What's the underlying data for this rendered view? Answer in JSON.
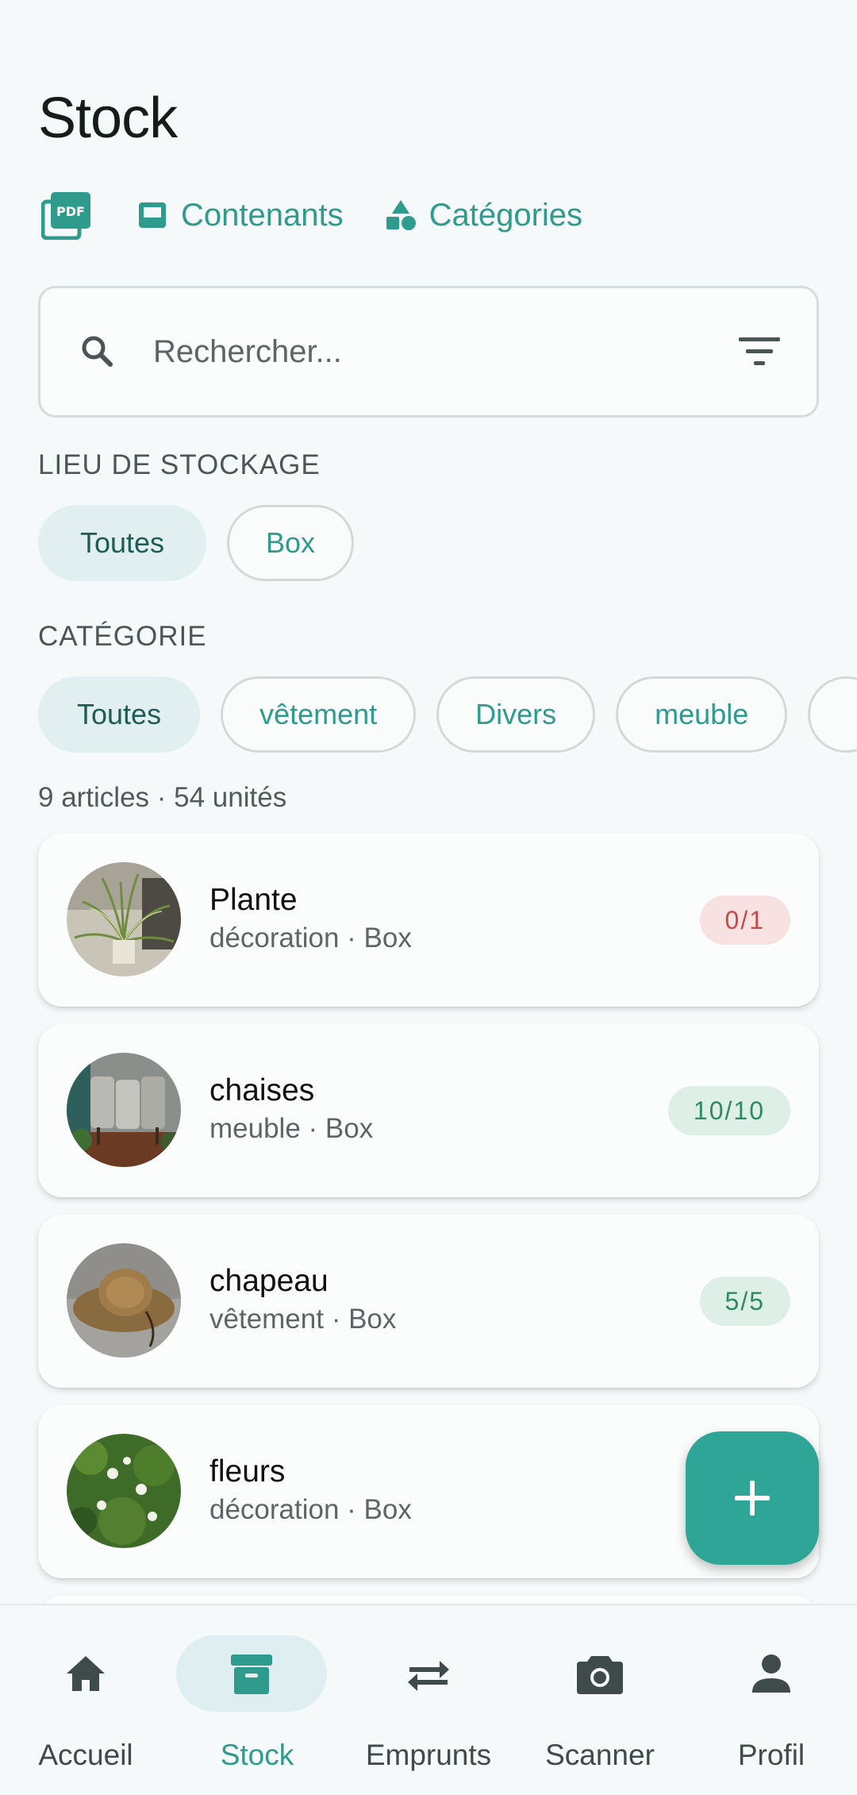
{
  "header": {
    "title": "Stock"
  },
  "toolbar": {
    "pdf_label": "PDF",
    "containers_label": "Contenants",
    "categories_label": "Catégories"
  },
  "search": {
    "placeholder": "Rechercher...",
    "value": ""
  },
  "storage_filter": {
    "label": "LIEU DE STOCKAGE",
    "chips": [
      {
        "label": "Toutes",
        "selected": true
      },
      {
        "label": "Box",
        "selected": false
      }
    ]
  },
  "category_filter": {
    "label": "CATÉGORIE",
    "chips": [
      {
        "label": "Toutes",
        "selected": true
      },
      {
        "label": "vêtement",
        "selected": false
      },
      {
        "label": "Divers",
        "selected": false
      },
      {
        "label": "meuble",
        "selected": false
      }
    ]
  },
  "summary": {
    "text": "9 articles · 54 unités"
  },
  "items": [
    {
      "name": "Plante",
      "meta": "décoration · Box",
      "badge": "0/1",
      "status": "empty",
      "thumb": "plant-photo"
    },
    {
      "name": "chaises",
      "meta": "meuble · Box",
      "badge": "10/10",
      "status": "available",
      "thumb": "chairs-photo"
    },
    {
      "name": "chapeau",
      "meta": "vêtement · Box",
      "badge": "5/5",
      "status": "available",
      "thumb": "hat-photo"
    },
    {
      "name": "fleurs",
      "meta": "décoration · Box",
      "badge": "",
      "status": "available",
      "thumb": "flowers-photo"
    }
  ],
  "fab": {
    "icon": "plus-icon"
  },
  "bottom_nav": [
    {
      "label": "Accueil",
      "icon": "home-icon",
      "active": false
    },
    {
      "label": "Stock",
      "icon": "archive-box-icon",
      "active": true
    },
    {
      "label": "Emprunts",
      "icon": "swap-arrows-icon",
      "active": false
    },
    {
      "label": "Scanner",
      "icon": "camera-icon",
      "active": false
    },
    {
      "label": "Profil",
      "icon": "person-icon",
      "active": false
    }
  ],
  "colors": {
    "accent": "#2e9b8d",
    "fab": "#2ea596",
    "badge_empty_bg": "#f8e1e1",
    "badge_empty_text": "#c54b4b",
    "badge_ok_bg": "#deefe8",
    "badge_ok_text": "#2e8a62"
  }
}
